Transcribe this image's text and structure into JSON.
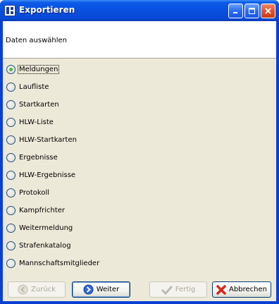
{
  "window": {
    "title": "Exportieren"
  },
  "header": {
    "title": "Daten auswählen"
  },
  "options": [
    {
      "label": "Meldungen",
      "checked": true
    },
    {
      "label": "Laufliste",
      "checked": false
    },
    {
      "label": "Startkarten",
      "checked": false
    },
    {
      "label": "HLW-Liste",
      "checked": false
    },
    {
      "label": "HLW-Startkarten",
      "checked": false
    },
    {
      "label": "Ergebnisse",
      "checked": false
    },
    {
      "label": "HLW-Ergebnisse",
      "checked": false
    },
    {
      "label": "Protokoll",
      "checked": false
    },
    {
      "label": "Kampfrichter",
      "checked": false
    },
    {
      "label": "Weitermeldung",
      "checked": false
    },
    {
      "label": "Strafenkatalog",
      "checked": false
    },
    {
      "label": "Mannschaftsmitglieder",
      "checked": false
    }
  ],
  "buttons": {
    "back": "Zurück",
    "next": "Weiter",
    "finish": "Fertig",
    "cancel": "Abbrechen"
  },
  "colors": {
    "titlebar": "#0a4fe0",
    "client": "#ece9d8",
    "radio_dot": "#21a121"
  }
}
